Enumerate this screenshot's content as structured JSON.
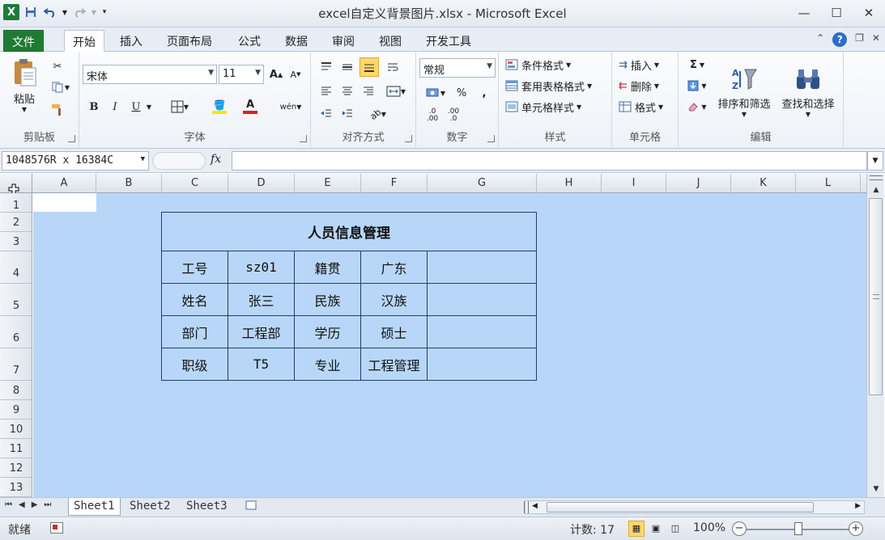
{
  "window": {
    "title": "excel自定义背景图片.xlsx - Microsoft Excel",
    "logo": "X"
  },
  "ribbon_tabs": [
    {
      "label": "文件"
    },
    {
      "label": "开始"
    },
    {
      "label": "插入"
    },
    {
      "label": "页面布局"
    },
    {
      "label": "公式"
    },
    {
      "label": "数据"
    },
    {
      "label": "审阅"
    },
    {
      "label": "视图"
    },
    {
      "label": "开发工具"
    }
  ],
  "clipboard": {
    "paste": "粘贴",
    "group": "剪贴板"
  },
  "font": {
    "name": "宋体",
    "size": "11",
    "group": "字体",
    "bold": "B",
    "italic": "I",
    "underline": "U",
    "grow": "A",
    "shrink": "A",
    "color_letter": "A",
    "phonetic": "wén",
    "font_color": "#e02020",
    "fill_color": "#ffe600"
  },
  "alignment": {
    "group": "对齐方式"
  },
  "number": {
    "format": "常规",
    "group": "数字",
    "percent": "%",
    "comma": ","
  },
  "styles": {
    "group": "样式",
    "conditional": "条件格式",
    "table_format": "套用表格格式",
    "cell_styles": "单元格样式"
  },
  "cells_group": {
    "group": "单元格",
    "insert": "插入",
    "delete": "删除",
    "format": "格式"
  },
  "editing": {
    "group": "编辑",
    "sum": "Σ",
    "sort_filter": "排序和筛选",
    "find_select": "查找和选择"
  },
  "formula_bar": {
    "name_box": "1048576R x 16384C",
    "fx": "fx",
    "value": ""
  },
  "columns": [
    "A",
    "B",
    "C",
    "D",
    "E",
    "F",
    "G",
    "H",
    "I",
    "J",
    "K",
    "L"
  ],
  "rows": [
    "1",
    "2",
    "3",
    "4",
    "5",
    "6",
    "7",
    "8",
    "9",
    "10",
    "11",
    "12",
    "13"
  ],
  "table": {
    "title": "人员信息管理",
    "rows": [
      [
        "工号",
        "sz01",
        "籍贯",
        "广东"
      ],
      [
        "姓名",
        "张三",
        "民族",
        "汉族"
      ],
      [
        "部门",
        "工程部",
        "学历",
        "硕士"
      ],
      [
        "职级",
        "T5",
        "专业",
        "工程管理"
      ]
    ]
  },
  "sheets": [
    {
      "label": "Sheet1"
    },
    {
      "label": "Sheet2"
    },
    {
      "label": "Sheet3"
    }
  ],
  "status": {
    "ready": "就绪",
    "count": "计数: 17",
    "zoom": "100%"
  },
  "colors": {
    "sheet_background": "#b8d7f8",
    "file_tab": "#217a33",
    "table_border": "#1d3f6c"
  }
}
